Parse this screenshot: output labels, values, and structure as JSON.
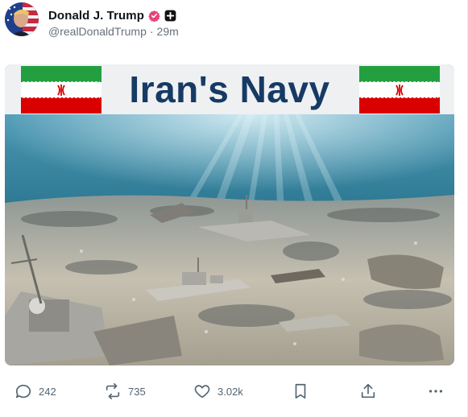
{
  "post": {
    "author": {
      "display_name": "Donald J. Trump",
      "handle": "@realDonaldTrump",
      "separator": "·",
      "time": "29m",
      "avatar_icon": "profile-avatar",
      "verified_icon": "verified-badge-icon",
      "verified_color": "#e8427b",
      "plus_icon": "plus-badge-icon"
    },
    "media": {
      "banner_title": "Iran's Navy",
      "flag_icon": "iran-flag",
      "flag_colors": {
        "green": "#239f40",
        "white": "#ffffff",
        "red": "#da0000"
      },
      "banner_text_color": "#173a64"
    },
    "actions": {
      "reply": {
        "icon": "reply-icon",
        "count": "242"
      },
      "repost": {
        "icon": "repost-icon",
        "count": "735"
      },
      "like": {
        "icon": "heart-icon",
        "count": "3.02k"
      },
      "bookmark": {
        "icon": "bookmark-icon"
      },
      "share": {
        "icon": "share-icon"
      },
      "more": {
        "icon": "more-icon"
      }
    }
  }
}
